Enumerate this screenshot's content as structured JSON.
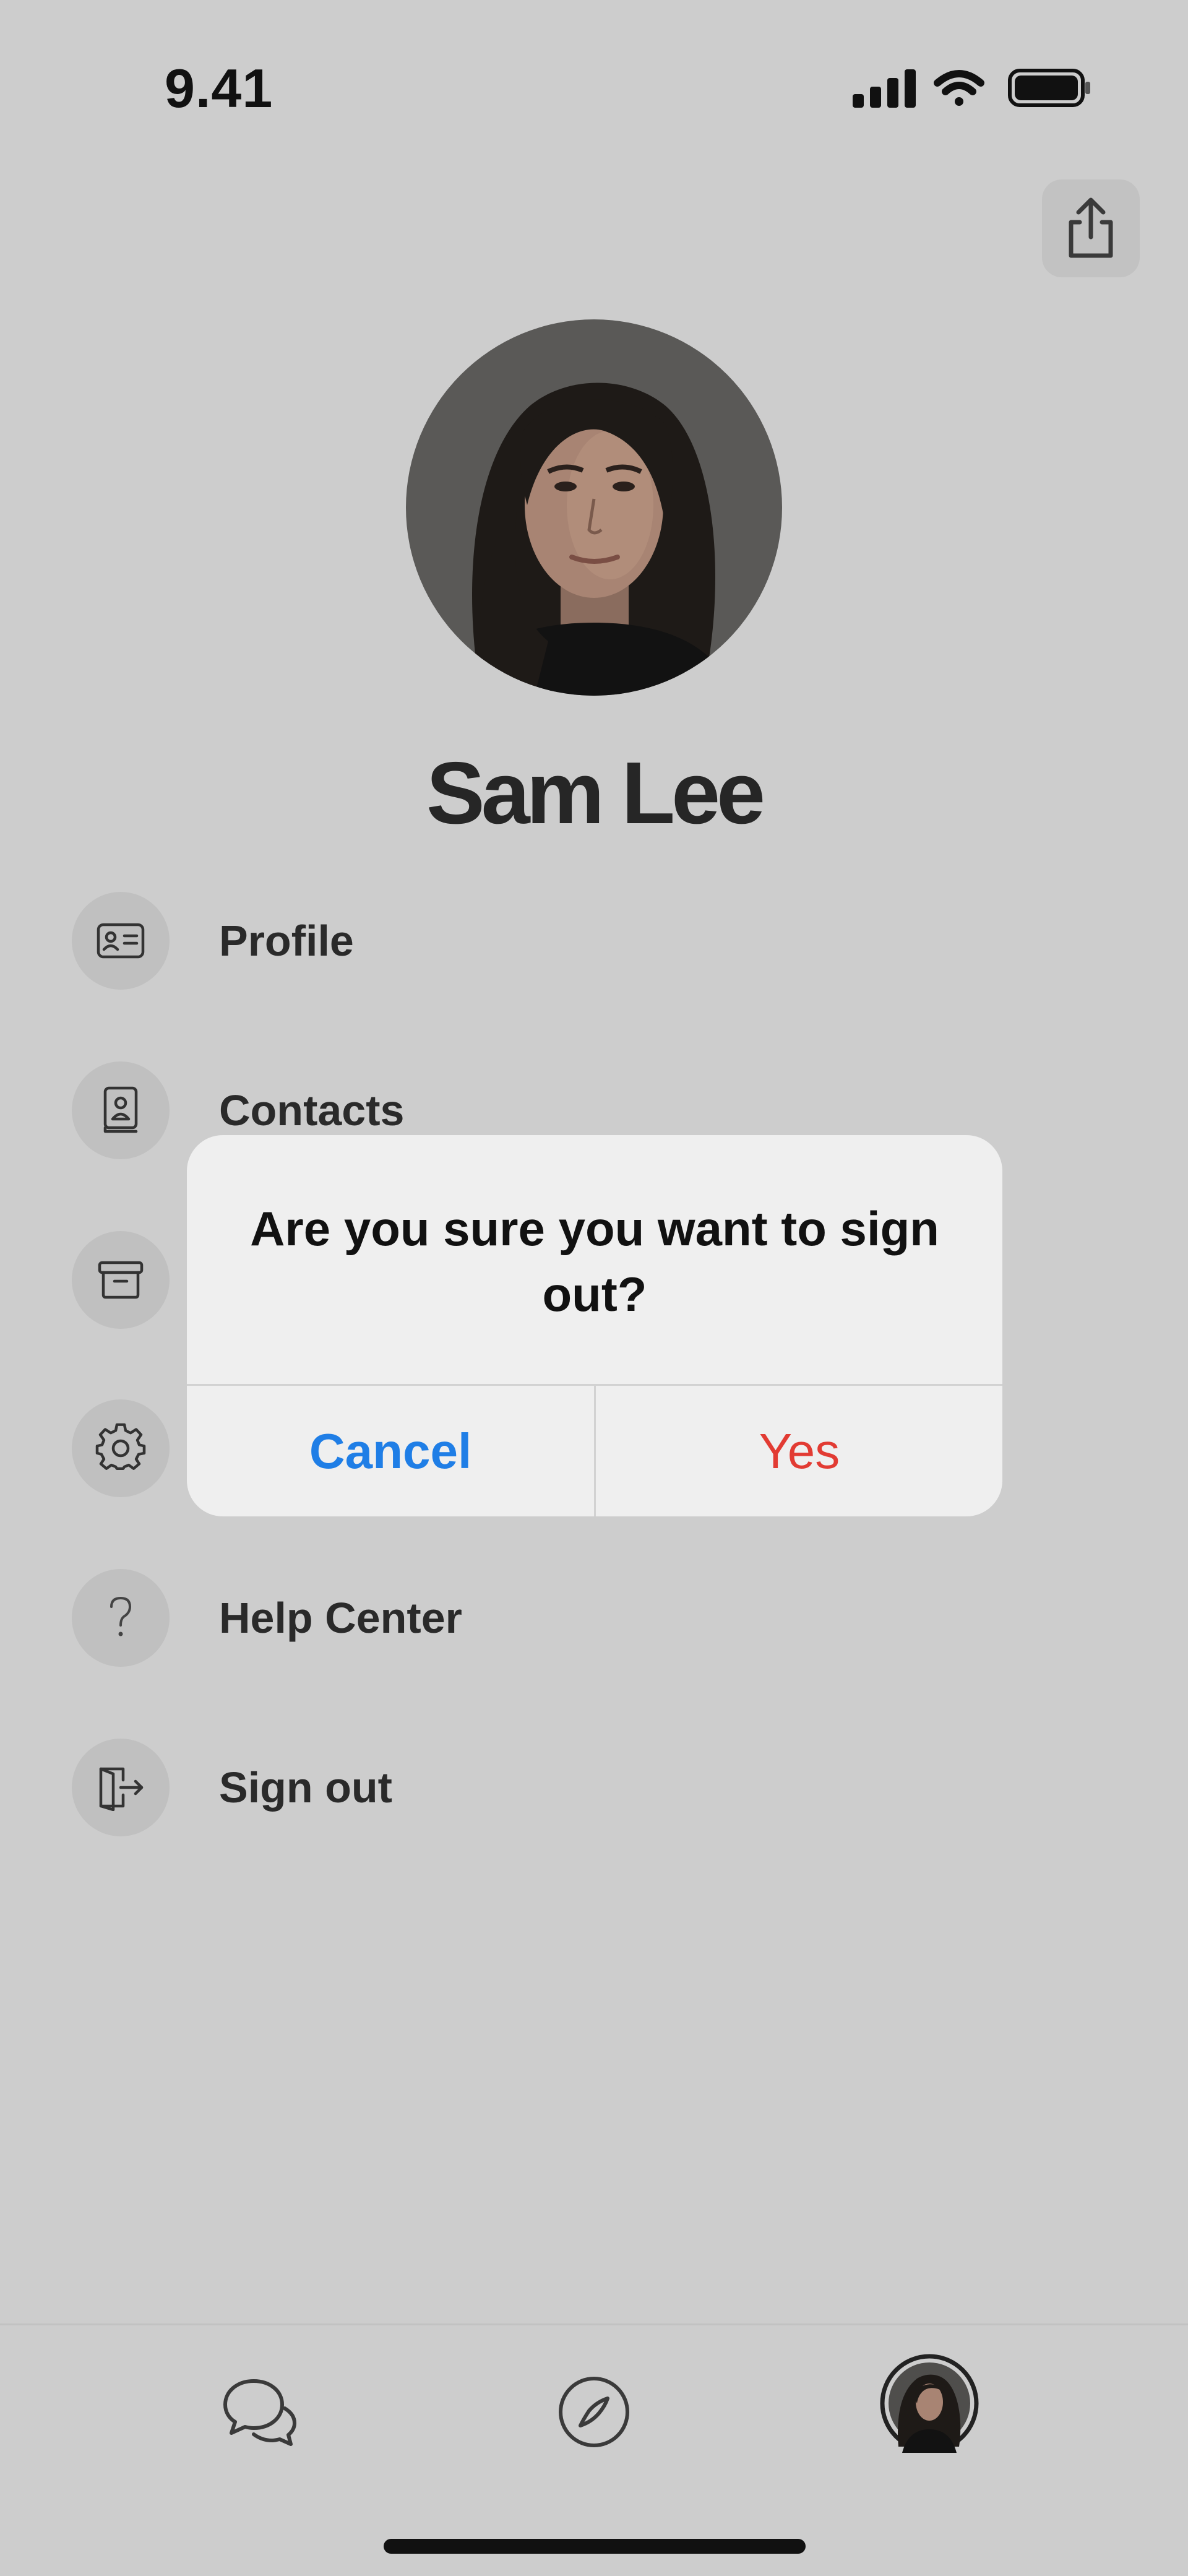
{
  "status": {
    "time": "9.41"
  },
  "profile": {
    "name": "Sam Lee"
  },
  "menu": [
    {
      "label": "Profile",
      "icon": "id-card-icon"
    },
    {
      "label": "Contacts",
      "icon": "contact-book-icon"
    },
    {
      "label": "",
      "icon": "archive-icon"
    },
    {
      "label": "",
      "icon": "gear-icon"
    },
    {
      "label": "Help Center",
      "icon": "question-icon"
    },
    {
      "label": "Sign out",
      "icon": "sign-out-icon"
    }
  ],
  "dialog": {
    "message": "Are you sure you want to sign out?",
    "cancel_label": "Cancel",
    "confirm_label": "Yes"
  },
  "tabs": [
    {
      "icon": "chat-bubbles-icon"
    },
    {
      "icon": "compass-icon"
    },
    {
      "icon": "avatar-icon"
    }
  ],
  "colors": {
    "background": "#cdcdcd",
    "dialog": "#efefef",
    "cancel": "#1f7ee6",
    "confirm": "#e23b33"
  }
}
